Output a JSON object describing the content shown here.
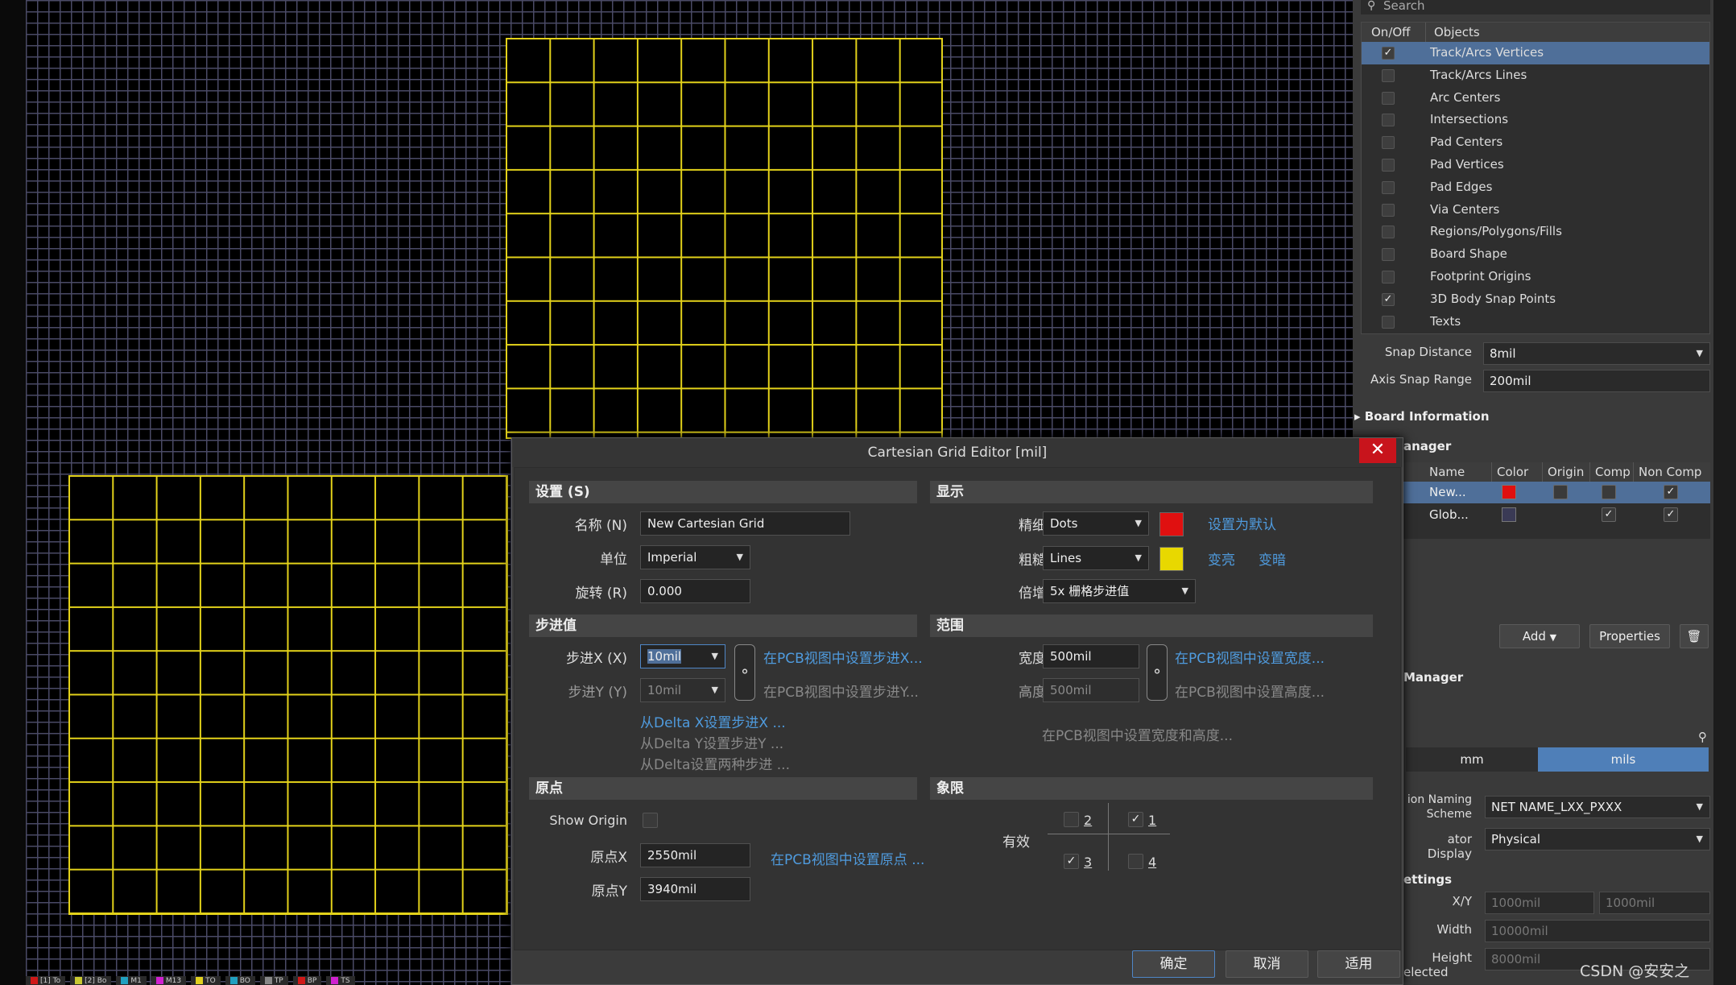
{
  "panel": {
    "search_placeholder": "Search",
    "objects_header": {
      "onoff": "On/Off",
      "objects": "Objects"
    },
    "objects": [
      {
        "label": "Track/Arcs Vertices",
        "checked": true,
        "selected": true
      },
      {
        "label": "Track/Arcs Lines",
        "checked": false
      },
      {
        "label": "Arc Centers",
        "checked": false
      },
      {
        "label": "Intersections",
        "checked": false
      },
      {
        "label": "Pad Centers",
        "checked": false
      },
      {
        "label": "Pad Vertices",
        "checked": false
      },
      {
        "label": "Pad Edges",
        "checked": false
      },
      {
        "label": "Via Centers",
        "checked": false
      },
      {
        "label": "Regions/Polygons/Fills",
        "checked": false
      },
      {
        "label": "Board Shape",
        "checked": false
      },
      {
        "label": "Footprint Origins",
        "checked": false
      },
      {
        "label": "3D Body Snap Points",
        "checked": true
      },
      {
        "label": "Texts",
        "checked": false
      }
    ],
    "snap_distance_label": "Snap Distance",
    "snap_distance_value": "8mil",
    "axis_snap_label": "Axis Snap Range",
    "axis_snap_value": "200mil",
    "board_info": "Board Information",
    "grid_manager": "anager",
    "grid_headers": {
      "name": "Name",
      "color": "Color",
      "origin": "Origin",
      "comp": "Comp",
      "noncomp": "Non Comp"
    },
    "grid_rows": [
      {
        "name": "New...",
        "color": "#e01010",
        "origin": false,
        "comp": false,
        "noncomp": true
      },
      {
        "name": "Glob...",
        "color": "#3a3a55",
        "comp": true,
        "noncomp": true
      }
    ],
    "add_label": "Add",
    "properties_label": "Properties",
    "trash_icon": "trash-icon",
    "guide_manager": "Manager",
    "units": {
      "mm": "mm",
      "mils": "mils",
      "active": "mils"
    },
    "naming_label_1": "ion Naming",
    "naming_label_2": "Scheme",
    "naming_value": "NET NAME_LXX_PXXX",
    "designator_label": "ator Display",
    "designator_value": "Physical",
    "settings_section": "ettings",
    "xy_label": "X/Y",
    "x_value": "1000mil",
    "y_value": "1000mil",
    "width_label": "Width",
    "width_value": "10000mil",
    "height_label": "Height",
    "height_value": "8000mil",
    "selected_label": "elected"
  },
  "layer_tabs": [
    {
      "label": "[1] To",
      "color": "#d01818"
    },
    {
      "label": "[2] Bo",
      "color": "#c8c832"
    },
    {
      "label": "M1",
      "color": "#20a0c0"
    },
    {
      "label": "M13",
      "color": "#d020d0"
    },
    {
      "label": "TO",
      "color": "#e0d020"
    },
    {
      "label": "BO",
      "color": "#20a0c0"
    },
    {
      "label": "TP",
      "color": "#888888"
    },
    {
      "label": "BP",
      "color": "#d01818"
    },
    {
      "label": "TS",
      "color": "#d020d0"
    }
  ],
  "dialog": {
    "title": "Cartesian Grid Editor [mil]",
    "close_icon": "close-icon",
    "settings": {
      "header": "设置 (S)",
      "name_label": "名称 (N)",
      "name_value": "New Cartesian Grid",
      "unit_label": "单位",
      "unit_value": "Imperial",
      "rotation_label": "旋转 (R)",
      "rotation_value": "0.000"
    },
    "display": {
      "header": "显示",
      "fine_label": "精细",
      "fine_value": "Dots",
      "fine_color": "#e01010",
      "coarse_label": "粗糙",
      "coarse_value": "Lines",
      "coarse_color": "#e8d800",
      "set_default": "设置为默认",
      "lighter": "变亮",
      "darker": "变暗",
      "multiplier_label": "倍增",
      "multiplier_value": "5x 栅格步进值"
    },
    "step": {
      "header": "步进值",
      "stepx_label": "步进X (X)",
      "stepx_value": "10mil",
      "stepy_label": "步进Y (Y)",
      "stepy_value": "10mil",
      "set_x_link": "在PCB视图中设置步进X...",
      "set_y_link": "在PCB视图中设置步进Y...",
      "delta_x": "从Delta X设置步进X ...",
      "delta_y": "从Delta Y设置步进Y ...",
      "delta_both": "从Delta设置两种步进 ..."
    },
    "range": {
      "header": "范围",
      "width_label": "宽度",
      "width_value": "500mil",
      "height_label": "高度",
      "height_value": "500mil",
      "set_width": "在PCB视图中设置宽度...",
      "set_height": "在PCB视图中设置高度...",
      "set_both": "在PCB视图中设置宽度和高度..."
    },
    "origin": {
      "header": "原点",
      "show_origin": "Show Origin",
      "ox_label": "原点X",
      "ox_value": "2550mil",
      "oy_label": "原点Y",
      "oy_value": "3940mil",
      "set_origin": "在PCB视图中设置原点 ..."
    },
    "quadrant": {
      "header": "象限",
      "valid_label": "有效",
      "q1": "1",
      "q2": "2",
      "q3": "3",
      "q4": "4"
    },
    "ok": "确定",
    "cancel": "取消",
    "apply": "适用"
  },
  "watermark": "CSDN @安安之"
}
